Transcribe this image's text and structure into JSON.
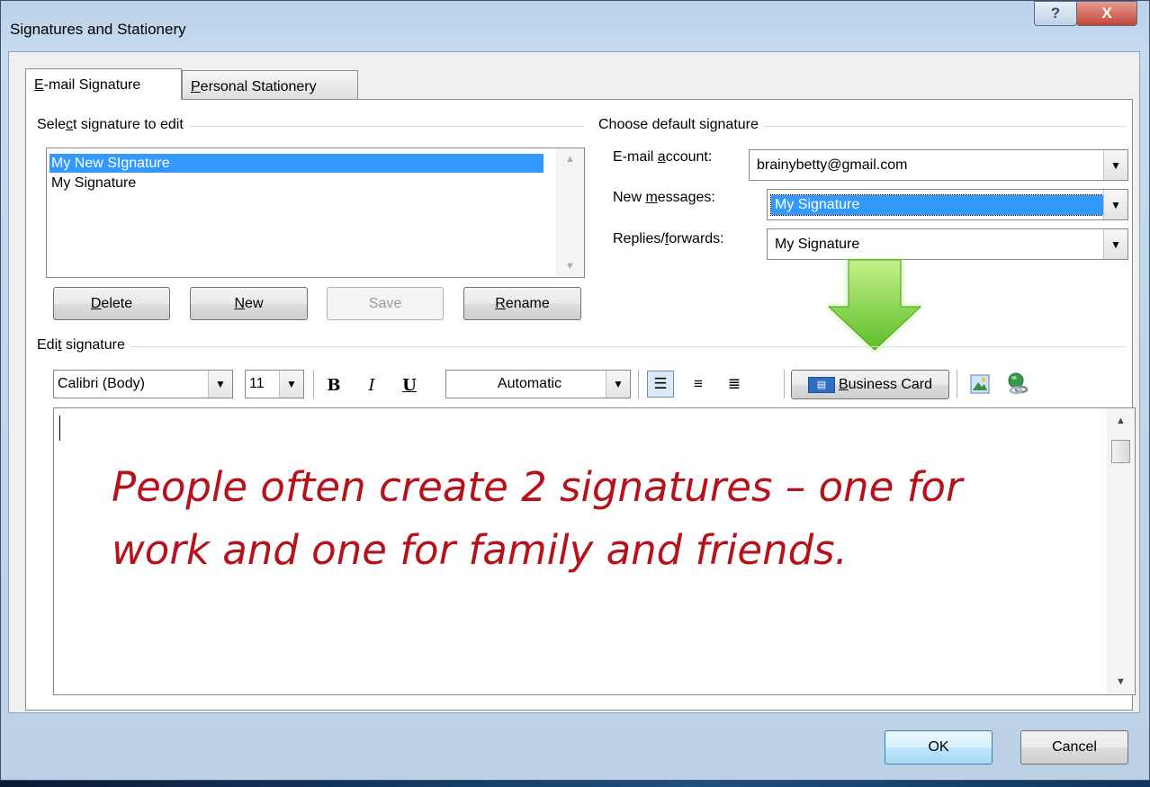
{
  "window": {
    "title": "Signatures and Stationery",
    "help_label": "?",
    "close_label": "X"
  },
  "tabs": [
    {
      "label_u": "E",
      "label_rest": "-mail Signature"
    },
    {
      "label_u": "P",
      "label_rest": "ersonal Stationery"
    }
  ],
  "select_group": {
    "pre": "Sele",
    "u": "c",
    "post": "t signature to edit"
  },
  "signatures": [
    "My New SIgnature",
    "My Signature"
  ],
  "buttons": {
    "delete": {
      "u": "D",
      "rest": "elete"
    },
    "new": {
      "u": "N",
      "rest": "ew"
    },
    "save": "Save",
    "rename": {
      "u": "R",
      "rest": "ename"
    }
  },
  "default_group": "Choose default signature",
  "email_account": {
    "pre": "E-mail ",
    "u": "a",
    "post": "ccount:",
    "value": "brainybetty@gmail.com"
  },
  "new_messages": {
    "pre": "New ",
    "u": "m",
    "post": "essages:",
    "value": "My Signature"
  },
  "replies": {
    "pre": "Replies/",
    "u": "f",
    "post": "orwards:",
    "value": "My Signature"
  },
  "edit_group": {
    "pre": "Edi",
    "u": "t",
    "post": " signature"
  },
  "toolbar": {
    "font": "Calibri (Body)",
    "size": "11",
    "bold": "B",
    "italic": "I",
    "underline": "U",
    "color": "Automatic",
    "business_card": {
      "u": "B",
      "rest": "usiness Card"
    }
  },
  "note": "People often create 2 signatures – one for work and one for family and friends.",
  "footer": {
    "ok": "OK",
    "cancel": "Cancel"
  },
  "colors": {
    "selection": "#3399ff",
    "note": "#b5121b",
    "arrow": "#7fd13b"
  }
}
